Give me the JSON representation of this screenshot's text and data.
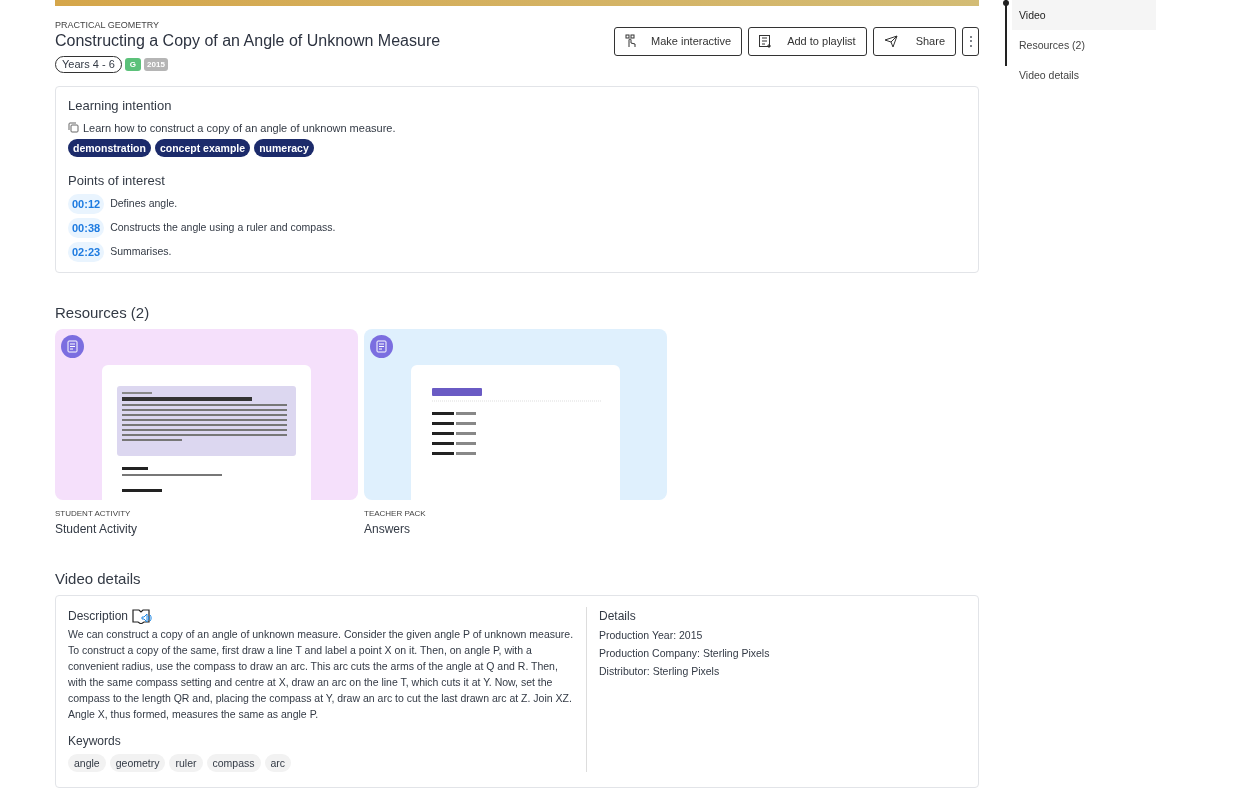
{
  "header": {
    "category": "PRACTICAL GEOMETRY",
    "title": "Constructing a Copy of an Angle of Unknown Measure",
    "badges": [
      {
        "kind": "outline",
        "label": "Years 4 - 6"
      },
      {
        "kind": "rating",
        "label": "G",
        "color": "#5cc17a"
      },
      {
        "kind": "year",
        "label": "2015",
        "color": "#b5b5b5"
      }
    ]
  },
  "actions": [
    {
      "kind": "interactive",
      "label": "Make interactive"
    },
    {
      "kind": "playlist",
      "label": "Add to playlist"
    },
    {
      "kind": "share",
      "label": "Share"
    },
    {
      "kind": "more",
      "label": "⋮"
    }
  ],
  "learning": {
    "heading": "Learning intention",
    "intention": "Learn how to construct a copy of an angle of unknown measure.",
    "tags": [
      "demonstration",
      "concept example",
      "numeracy"
    ],
    "poi_heading": "Points of interest",
    "points": [
      {
        "time": "00:12",
        "text": "Defines angle."
      },
      {
        "time": "00:38",
        "text": "Constructs the angle using a ruler and compass."
      },
      {
        "time": "02:23",
        "text": "Summarises."
      }
    ]
  },
  "resources": {
    "heading": "Resources (2)",
    "items": [
      {
        "kind": "activity",
        "type": "STUDENT ACTIVITY",
        "title": "Student Activity",
        "color": "#f5e0fb"
      },
      {
        "kind": "answers",
        "type": "TEACHER PACK",
        "title": "Answers",
        "color": "#dff0fd"
      }
    ]
  },
  "video_details": {
    "heading": "Video details",
    "description_heading": "Description",
    "description": "We can construct a copy of an angle of unknown measure. Consider the given angle P of unknown measure. To construct a copy of the same, first draw a line T and label a point X on it. Then, on angle P, with a convenient radius, use the compass to draw an arc. This arc cuts the arms of the angle at Q and R. Then, with the same compass setting and centre at X, draw an arc on the line T, which cuts it at Y. Now, set the compass to the length QR and, placing the compass at Y, draw an arc to cut the last drawn arc at Z. Join XZ. Angle X, thus formed, measures the same as angle P.",
    "keywords_heading": "Keywords",
    "keywords": [
      "angle",
      "geometry",
      "ruler",
      "compass",
      "arc"
    ],
    "details_heading": "Details",
    "details": [
      "Production Year: 2015",
      "Production Company: Sterling Pixels",
      "Distributor: Sterling Pixels"
    ]
  },
  "sidebar": {
    "items": [
      {
        "label": "Video",
        "selected": true
      },
      {
        "label": "Resources (2)",
        "selected": false
      },
      {
        "label": "Video details",
        "selected": false
      }
    ]
  }
}
